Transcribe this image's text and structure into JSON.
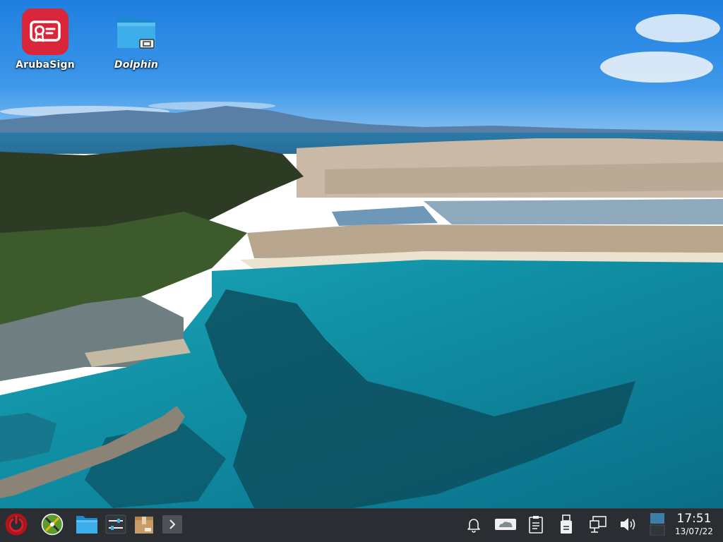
{
  "desktop": {
    "icons": [
      {
        "label": "ArubaSign",
        "icon": "arubasign-certificate-icon",
        "accent": "#d9263a"
      },
      {
        "label": "Dolphin",
        "icon": "folder-icon",
        "accent": "#3daee9"
      }
    ]
  },
  "taskbar": {
    "background": "#2a2e32",
    "launcher_icon": "power-circle-icon",
    "pinned": [
      {
        "name": "compass-app-icon"
      },
      {
        "name": "folder-icon"
      },
      {
        "name": "sliders-settings-icon"
      },
      {
        "name": "package-box-icon"
      },
      {
        "name": "chevron-right-icon"
      }
    ],
    "tray": [
      {
        "name": "bell-icon"
      },
      {
        "name": "cloud-drive-icon"
      },
      {
        "name": "clipboard-icon"
      },
      {
        "name": "usb-device-icon"
      },
      {
        "name": "network-icon"
      },
      {
        "name": "volume-icon"
      },
      {
        "name": "desktop-pager-icon"
      }
    ],
    "clock": {
      "time": "17:51",
      "date": "13/07/22"
    }
  }
}
